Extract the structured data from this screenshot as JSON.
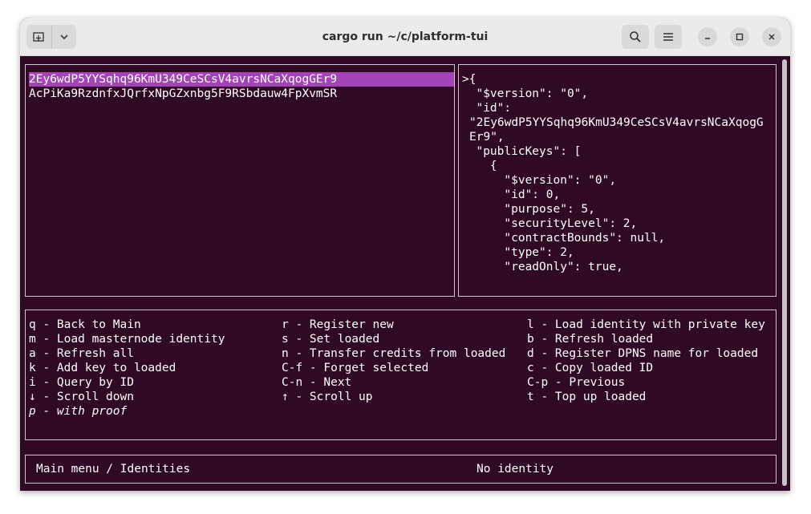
{
  "window": {
    "title": "cargo run ~/c/platform-tui",
    "icons": {
      "new_tab": "new-tab-icon",
      "dropdown": "chevron-down-icon",
      "search": "search-icon",
      "menu": "hamburger-menu-icon",
      "minimize": "minimize-icon",
      "maximize": "maximize-icon",
      "close": "close-icon"
    }
  },
  "colors": {
    "terminal_bg": "#300a24",
    "selection": "#a442b8",
    "border": "#cfc7cc",
    "text": "#ffffff"
  },
  "identities": {
    "selected_index": 0,
    "items": [
      "2Ey6wdP5YYSqhq96KmU349CeSCsV4avrsNCaXqogGEr9",
      "AcPiKa9RzdnfxJQrfxNpGZxnbg5F9RSbdauw4FpXvmSR"
    ]
  },
  "json_view": {
    "lines": [
      ">{",
      "  \"$version\": \"0\",",
      "  \"id\":",
      "\"2Ey6wdP5YYSqhq96KmU349CeSCsV4avrsNCaXqogG",
      "Er9\",",
      "  \"publicKeys\": [",
      "    {",
      "      \"$version\": \"0\",",
      "      \"id\": 0,",
      "      \"purpose\": 5,",
      "      \"securityLevel\": 2,",
      "      \"contractBounds\": null,",
      "      \"type\": 2,",
      "      \"readOnly\": true,"
    ]
  },
  "keybindings": {
    "col1": [
      "q - Back to Main",
      "m - Load masternode identity",
      "a - Refresh all",
      "k - Add key to loaded",
      "i - Query by ID",
      "↓ - Scroll down",
      "p - with proof"
    ],
    "col2": [
      "r - Register new",
      "s - Set loaded",
      "n - Transfer credits from loaded",
      "C-f - Forget selected",
      "C-n - Next",
      "↑ - Scroll up"
    ],
    "col3": [
      "l - Load identity with private key",
      "b - Refresh loaded",
      "d - Register DPNS name for loaded",
      "c - Copy loaded ID",
      "C-p - Previous",
      "t - Top up loaded"
    ]
  },
  "status_bar": {
    "breadcrumb": "Main menu / Identities",
    "identity_status": "No identity"
  }
}
